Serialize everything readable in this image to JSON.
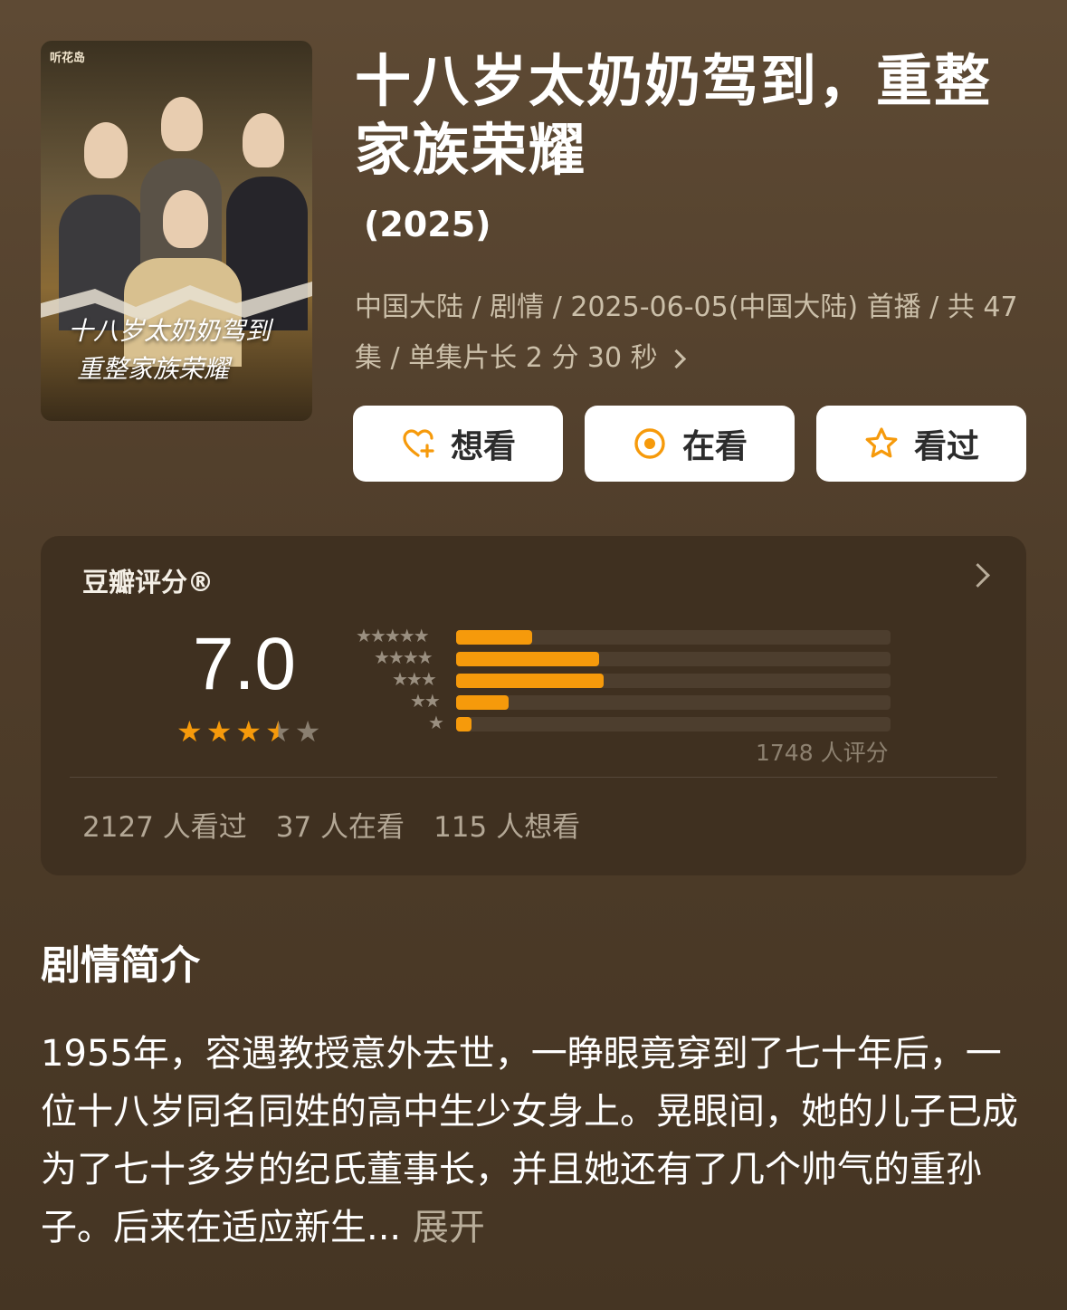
{
  "poster": {
    "brand": "听花岛",
    "title_line1": "十八岁太奶奶驾到",
    "title_line2": "重整家族荣耀"
  },
  "title": "十八岁太奶奶驾到，重整家族荣耀",
  "year": "(2025)",
  "meta": "中国大陆 / 剧情 / 2025-06-05(中国大陆) 首播 / 共 47 集 / 单集片长 2 分 30 秒",
  "buttons": {
    "want": "想看",
    "watching": "在看",
    "watched": "看过"
  },
  "rating": {
    "header": "豆瓣评分®",
    "score": "7.0",
    "stars": 3.5,
    "votes": "1748 人评分",
    "distribution": [
      {
        "label": "★★★★★",
        "percent": 17.5
      },
      {
        "label": "★★★★",
        "percent": 33
      },
      {
        "label": "★★★",
        "percent": 34
      },
      {
        "label": "★★",
        "percent": 12
      },
      {
        "label": "★",
        "percent": 3.5
      }
    ],
    "watched": "2127 人看过",
    "watching": "37 人在看",
    "want": "115 人想看"
  },
  "synopsis": {
    "heading": "剧情简介",
    "text": "1955年，容遇教授意外去世，一睁眼竟穿到了七十年后，一位十八岁同名同姓的高中生少女身上。晃眼间，她的儿子已成为了七十多岁的纪氏董事长，并且她还有了几个帅气的重孙子。后来在适应新生...",
    "more": "展开"
  },
  "colors": {
    "accent": "#f69a0b",
    "card": "#3f3020"
  }
}
